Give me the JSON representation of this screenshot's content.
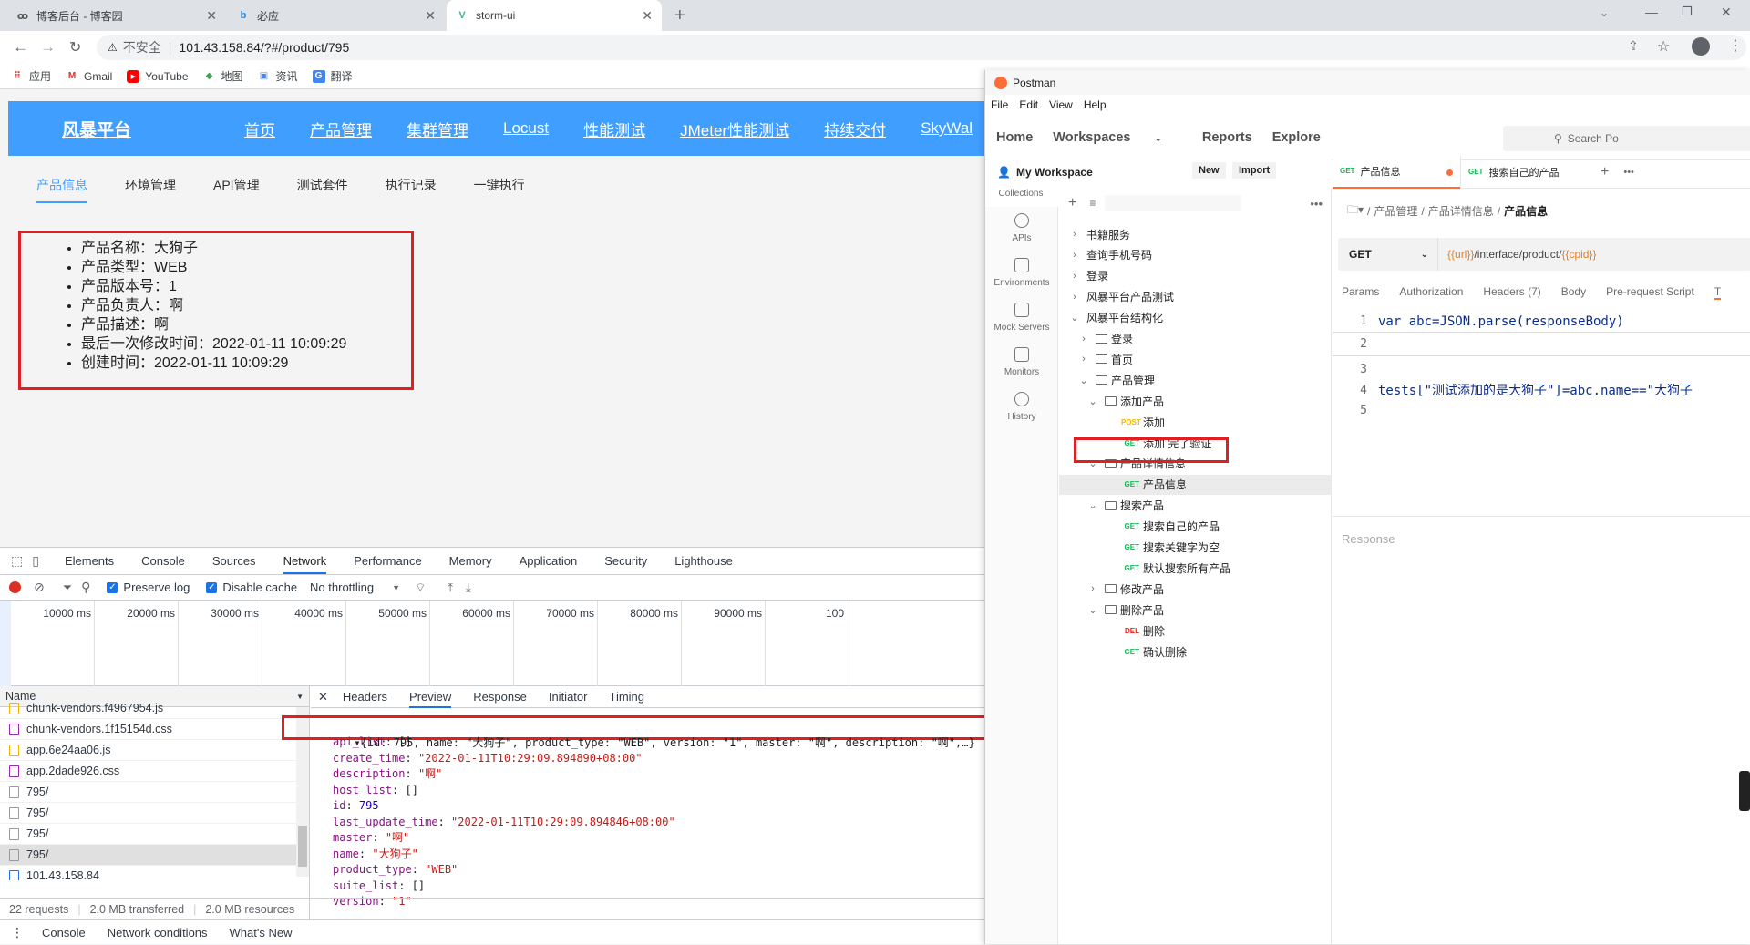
{
  "browser": {
    "tabs": [
      {
        "title": "博客后台 - 博客园",
        "icon": "cnblogs-icon"
      },
      {
        "title": "必应",
        "icon": "bing-icon"
      },
      {
        "title": "storm-ui",
        "icon": "vue-icon"
      }
    ],
    "address": {
      "security": "不安全",
      "url": "101.43.158.84/?#/product/795"
    },
    "bookmarks": [
      {
        "label": "应用",
        "icon": "apps-icon"
      },
      {
        "label": "Gmail",
        "icon": "gmail-icon"
      },
      {
        "label": "YouTube",
        "icon": "youtube-icon"
      },
      {
        "label": "地图",
        "icon": "maps-icon"
      },
      {
        "label": "资讯",
        "icon": "news-icon"
      },
      {
        "label": "翻译",
        "icon": "translate-icon"
      }
    ]
  },
  "app": {
    "brand": "风暴平台",
    "nav": [
      "首页",
      "产品管理",
      "集群管理",
      "Locust",
      "性能测试",
      "JMeter性能测试",
      "持续交付",
      "SkyWal"
    ],
    "subtabs": [
      "产品信息",
      "环境管理",
      "API管理",
      "测试套件",
      "执行记录",
      "一键执行"
    ],
    "product": [
      "产品名称：大狗子",
      "产品类型：WEB",
      "产品版本号：1",
      "产品负责人：啊",
      "产品描述：啊",
      "最后一次修改时间：2022-01-11 10:09:29",
      "创建时间：2022-01-11 10:09:29"
    ]
  },
  "devtools": {
    "tabs": [
      "Elements",
      "Console",
      "Sources",
      "Network",
      "Performance",
      "Memory",
      "Application",
      "Security",
      "Lighthouse"
    ],
    "toolbar": {
      "preserve_log": "Preserve log",
      "disable_cache": "Disable cache",
      "throttling": "No throttling"
    },
    "timeline_ticks": [
      "10000 ms",
      "20000 ms",
      "30000 ms",
      "40000 ms",
      "50000 ms",
      "60000 ms",
      "70000 ms",
      "80000 ms",
      "90000 ms",
      "100"
    ],
    "name_header": "Name",
    "requests": [
      {
        "name": "chunk-vendors.f4967954.js",
        "type": "js"
      },
      {
        "name": "chunk-vendors.1f15154d.css",
        "type": "css"
      },
      {
        "name": "app.6e24aa06.js",
        "type": "js"
      },
      {
        "name": "app.2dade926.css",
        "type": "css"
      },
      {
        "name": "795/",
        "type": "doc"
      },
      {
        "name": "795/",
        "type": "doc"
      },
      {
        "name": "795/",
        "type": "doc"
      },
      {
        "name": "795/",
        "type": "doc"
      },
      {
        "name": "101.43.158.84",
        "type": "html"
      }
    ],
    "detail_tabs": [
      "Headers",
      "Preview",
      "Response",
      "Initiator",
      "Timing"
    ],
    "preview_summary": "{id: 795, name: \"大狗子\", product_type: \"WEB\", version: \"1\", master: \"啊\", description: \"啊\",…}",
    "preview_lines": [
      {
        "key": "api_list",
        "val": "[]",
        "kind": "p"
      },
      {
        "key": "create_time",
        "val": "\"2022-01-11T10:29:09.894890+08:00\"",
        "kind": "s"
      },
      {
        "key": "description",
        "val": "\"啊\"",
        "kind": "s"
      },
      {
        "key": "host_list",
        "val": "[]",
        "kind": "p"
      },
      {
        "key": "id",
        "val": "795",
        "kind": "n"
      },
      {
        "key": "last_update_time",
        "val": "\"2022-01-11T10:29:09.894846+08:00\"",
        "kind": "s"
      },
      {
        "key": "master",
        "val": "\"啊\"",
        "kind": "s"
      },
      {
        "key": "name",
        "val": "\"大狗子\"",
        "kind": "s"
      },
      {
        "key": "product_type",
        "val": "\"WEB\"",
        "kind": "s"
      },
      {
        "key": "suite_list",
        "val": "[]",
        "kind": "p"
      },
      {
        "key": "version",
        "val": "\"1\"",
        "kind": "s"
      }
    ],
    "status": [
      "22 requests",
      "2.0 MB transferred",
      "2.0 MB resources"
    ],
    "drawer": [
      "Console",
      "Network conditions",
      "What's New"
    ]
  },
  "postman": {
    "title": "Postman",
    "menu": [
      "File",
      "Edit",
      "View",
      "Help"
    ],
    "header": [
      "Home",
      "Workspaces",
      "Reports",
      "Explore"
    ],
    "search": "Search Po",
    "workspace": "My Workspace",
    "new_btn": "New",
    "import_btn": "Import",
    "sidebar": [
      "Collections",
      "APIs",
      "Environments",
      "Mock Servers",
      "Monitors",
      "History"
    ],
    "tree": [
      {
        "label": "书籍服务",
        "level": 0,
        "kind": "coll",
        "open": false
      },
      {
        "label": "查询手机号码",
        "level": 0,
        "kind": "coll",
        "open": false
      },
      {
        "label": "登录",
        "level": 0,
        "kind": "coll",
        "open": false
      },
      {
        "label": "风暴平台产品测试",
        "level": 0,
        "kind": "coll",
        "open": false
      },
      {
        "label": "风暴平台结构化",
        "level": 0,
        "kind": "coll",
        "open": true
      },
      {
        "label": "登录",
        "level": 1,
        "kind": "folder",
        "open": false
      },
      {
        "label": "首页",
        "level": 1,
        "kind": "folder",
        "open": false
      },
      {
        "label": "产品管理",
        "level": 1,
        "kind": "folder",
        "open": true
      },
      {
        "label": "添加产品",
        "level": 2,
        "kind": "folder",
        "open": true
      },
      {
        "label": "添加",
        "level": 3,
        "kind": "req",
        "method": "POST"
      },
      {
        "label": "添加 完了验证",
        "level": 3,
        "kind": "req",
        "method": "GET"
      },
      {
        "label": "产品详情信息",
        "level": 2,
        "kind": "folder",
        "open": true
      },
      {
        "label": "产品信息",
        "level": 3,
        "kind": "req",
        "method": "GET",
        "selected": true
      },
      {
        "label": "搜索产品",
        "level": 2,
        "kind": "folder",
        "open": true
      },
      {
        "label": "搜索自己的产品",
        "level": 3,
        "kind": "req",
        "method": "GET"
      },
      {
        "label": "搜索关键字为空",
        "level": 3,
        "kind": "req",
        "method": "GET"
      },
      {
        "label": "默认搜索所有产品",
        "level": 3,
        "kind": "req",
        "method": "GET"
      },
      {
        "label": "修改产品",
        "level": 2,
        "kind": "folder",
        "open": false
      },
      {
        "label": "删除产品",
        "level": 2,
        "kind": "folder",
        "open": true
      },
      {
        "label": "删除",
        "level": 3,
        "kind": "req",
        "method": "DEL"
      },
      {
        "label": "确认删除",
        "level": 3,
        "kind": "req",
        "method": "GET"
      }
    ],
    "open_tabs": [
      {
        "method": "GET",
        "label": "产品信息",
        "active": true
      },
      {
        "method": "GET",
        "label": "搜索自己的产品",
        "active": false
      }
    ],
    "breadcrumb": [
      "产品管理",
      "产品详情信息",
      "产品信息"
    ],
    "method": "GET",
    "url_parts": [
      "{{url}}",
      "/interface/product/",
      "{{cpid}}"
    ],
    "req_tabs": [
      "Params",
      "Authorization",
      "Headers (7)",
      "Body",
      "Pre-request Script",
      "T"
    ],
    "code_lines": [
      "var abc=JSON.parse(responseBody)",
      "",
      "",
      "tests[\"测试添加的是大狗子\"]=abc.name==\"大狗子",
      ""
    ],
    "response_label": "Response"
  }
}
